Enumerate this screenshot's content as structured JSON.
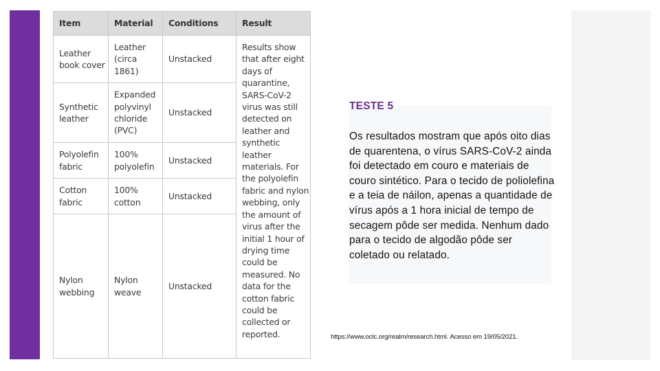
{
  "colors": {
    "accent": "#6f2f9f",
    "title": "#6b2f8f",
    "header_bg": "#dcdcdc",
    "side_panel": "#f4f4f4"
  },
  "table": {
    "headers": [
      "Item",
      "Material",
      "Conditions",
      "Result"
    ],
    "rows": [
      {
        "item": "Leather book cover",
        "material": "Leather (circa 1861)",
        "conditions": "Unstacked"
      },
      {
        "item": "Synthetic leather",
        "material": "Expanded polyvinyl chloride (PVC)",
        "conditions": "Unstacked"
      },
      {
        "item": "Polyolefin fabric",
        "material": "100% polyolefin",
        "conditions": "Unstacked"
      },
      {
        "item": "Cotton fabric",
        "material": "100% cotton",
        "conditions": "Unstacked"
      },
      {
        "item": "Nylon webbing",
        "material": "Nylon weave",
        "conditions": "Unstacked"
      }
    ],
    "result": "Results show that after eight days of quarantine, SARS-CoV-2 virus was still detected on leather and synthetic leather materials. For the polyolefin fabric and nylon webbing, only the amount of virus after the initial 1 hour of drying time could be measured. No data for the cotton fabric could be collected or reported."
  },
  "panel": {
    "title": "TESTE 5",
    "body": "Os resultados mostram que após oito dias de quarentena, o vírus SARS-CoV-2 ainda foi detectado em couro e materiais de couro sintético. Para o tecido de poliolefina e a teia de náilon, apenas a quantidade de vírus após a 1 hora inicial de tempo de secagem pôde ser medida. Nenhum dado para o tecido de algodão pôde ser coletado ou relatado."
  },
  "source": "https://www.oclc.org/realm/research.html. Acesso em 19/05/2021."
}
